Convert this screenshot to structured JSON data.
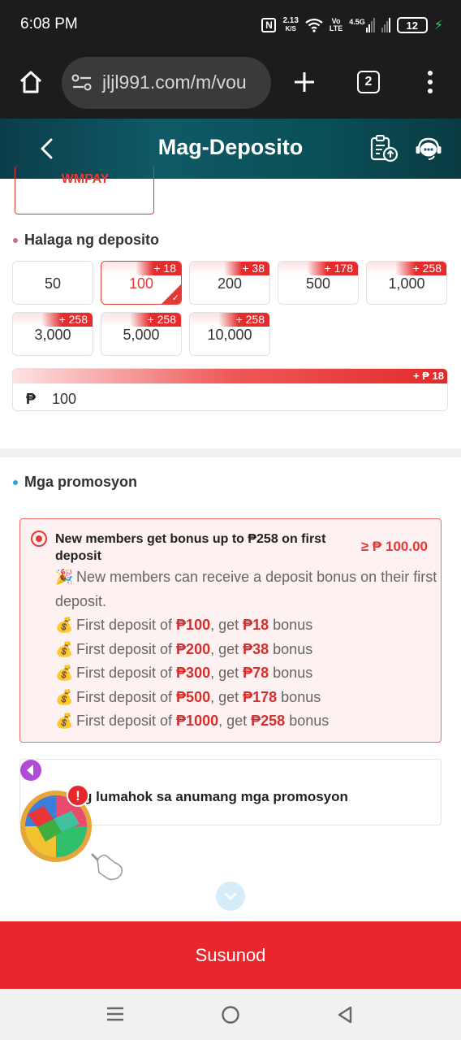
{
  "status_bar": {
    "time": "6:08 PM",
    "net_speed_value": "2.13",
    "net_speed_unit": "K/S",
    "nfc": "N",
    "volte_top": "Vo",
    "volte_bottom": "LTE",
    "network": "4.5G",
    "battery": "12"
  },
  "browser": {
    "url": "jljl991.com/m/vou",
    "tab_count": "2"
  },
  "header": {
    "title": "Mag-Deposito"
  },
  "payment_method": {
    "label": "WMPAY"
  },
  "deposit_amount": {
    "section_title": "Halaga ng deposito",
    "options": [
      {
        "value": "50",
        "bonus": ""
      },
      {
        "value": "100",
        "bonus": "+ 18",
        "selected": true
      },
      {
        "value": "200",
        "bonus": "+ 38"
      },
      {
        "value": "500",
        "bonus": "+ 178"
      },
      {
        "value": "1,000",
        "bonus": "+ 258"
      },
      {
        "value": "3,000",
        "bonus": "+ 258"
      },
      {
        "value": "5,000",
        "bonus": "+ 258"
      },
      {
        "value": "10,000",
        "bonus": "+ 258"
      }
    ],
    "input_currency": "₱",
    "input_value": "100",
    "input_bonus": "+ ₱ 18"
  },
  "promotions": {
    "section_title": "Mga promosyon",
    "card": {
      "title": "New members get bonus up to ₱258 on first deposit",
      "min_amount": "≥ ₱ 100.00",
      "intro_emoji": "🎉",
      "intro": "New members can receive a deposit bonus on their first deposit.",
      "tier_emoji": "💰",
      "tiers": [
        {
          "prefix": "First deposit of ",
          "amount": "₱100",
          "mid": ", get ",
          "bonus": "₱18",
          "suffix": " bonus"
        },
        {
          "prefix": "First deposit of ",
          "amount": "₱200",
          "mid": ", get ",
          "bonus": "₱38",
          "suffix": " bonus"
        },
        {
          "prefix": "First deposit of ",
          "amount": "₱300",
          "mid": ", get ",
          "bonus": "₱78",
          "suffix": " bonus"
        },
        {
          "prefix": "First deposit of ",
          "amount": "₱500",
          "mid": ", get ",
          "bonus": "₱178",
          "suffix": " bonus"
        },
        {
          "prefix": "First deposit of ",
          "amount": "₱1000",
          "mid": ", get ",
          "bonus": "₱258",
          "suffix": " bonus"
        }
      ]
    },
    "no_promo_label": "g lumahok sa anumang mga promosyon"
  },
  "floating_widget": {
    "badge": "!"
  },
  "footer": {
    "next_label": "Susunod"
  },
  "colors": {
    "accent": "#e53935",
    "header_teal": "#0f5a66",
    "button_red": "#e8262c"
  }
}
